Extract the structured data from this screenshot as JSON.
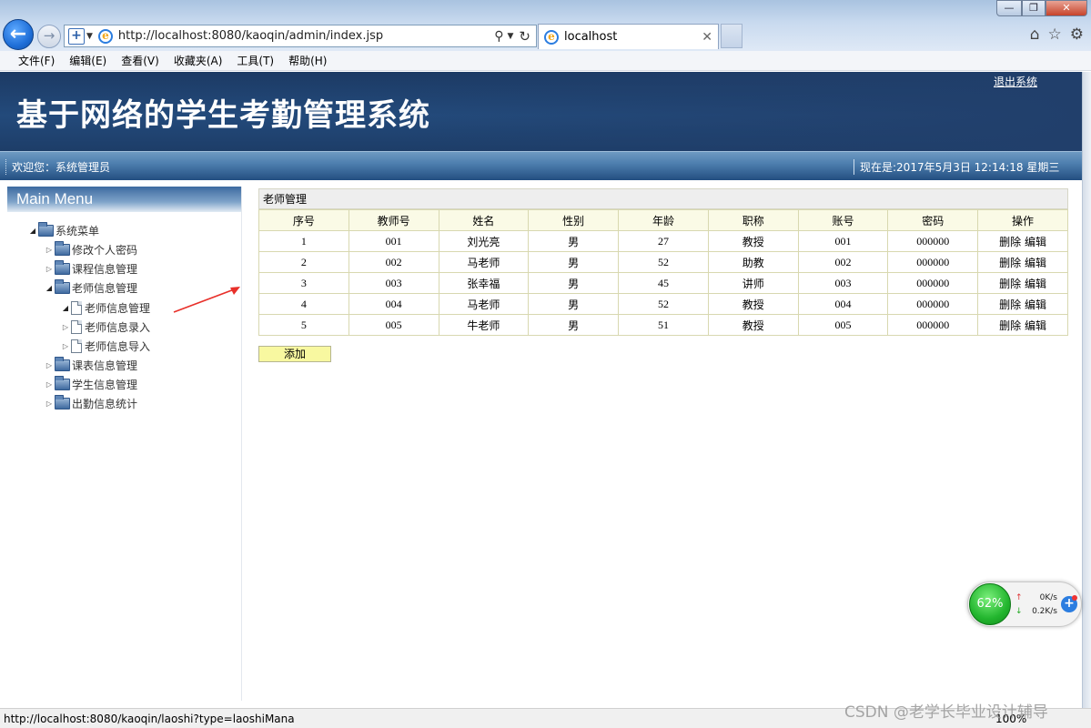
{
  "browser": {
    "url": "http://localhost:8080/kaoqin/admin/index.jsp",
    "tab_title": "localhost",
    "menu": [
      "文件(F)",
      "编辑(E)",
      "查看(V)",
      "收藏夹(A)",
      "工具(T)",
      "帮助(H)"
    ],
    "status_url": "http://localhost:8080/kaoqin/laoshi?type=laoshiMana",
    "zoom": "100%"
  },
  "header": {
    "title": "基于网络的学生考勤管理系统",
    "logout": "退出系统",
    "welcome": "欢迎您：系统管理员",
    "datetime": "现在是:2017年5月3日 12:14:18 星期三"
  },
  "sidebar": {
    "menu_title": "Main Menu",
    "root": "系统菜单",
    "items": [
      {
        "label": "修改个人密码"
      },
      {
        "label": "课程信息管理"
      },
      {
        "label": "老师信息管理",
        "children": [
          "老师信息管理",
          "老师信息录入",
          "老师信息导入"
        ]
      },
      {
        "label": "课表信息管理"
      },
      {
        "label": "学生信息管理"
      },
      {
        "label": "出勤信息统计"
      }
    ]
  },
  "content": {
    "section_title": "老师管理",
    "columns": [
      "序号",
      "教师号",
      "姓名",
      "性别",
      "年龄",
      "职称",
      "账号",
      "密码",
      "操作"
    ],
    "rows": [
      [
        "1",
        "001",
        "刘光亮",
        "男",
        "27",
        "教授",
        "001",
        "000000"
      ],
      [
        "2",
        "002",
        "马老师",
        "男",
        "52",
        "助教",
        "002",
        "000000"
      ],
      [
        "3",
        "003",
        "张幸福",
        "男",
        "45",
        "讲师",
        "003",
        "000000"
      ],
      [
        "4",
        "004",
        "马老师",
        "男",
        "52",
        "教授",
        "004",
        "000000"
      ],
      [
        "5",
        "005",
        "牛老师",
        "男",
        "51",
        "教授",
        "005",
        "000000"
      ]
    ],
    "delete_label": "删除",
    "edit_label": "编辑",
    "add_label": "添加"
  },
  "widget": {
    "memory": "62%",
    "up_speed": "0K/s",
    "down_speed": "0.2K/s"
  },
  "watermark": "CSDN @老学长毕业设计辅导",
  "colors": {
    "header_bg": "#1f4270",
    "table_header_bg": "#fafae6",
    "add_button_bg": "#f8f8a0",
    "annotation_arrow": "#e8302a"
  }
}
